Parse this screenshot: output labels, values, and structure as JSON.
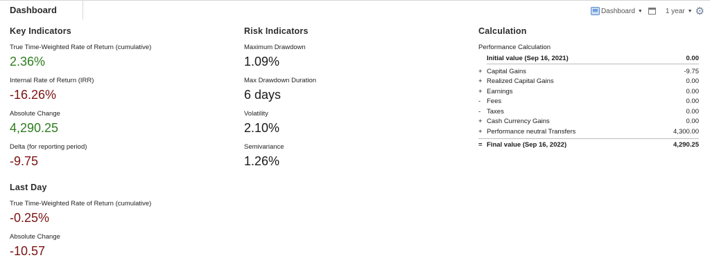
{
  "header": {
    "title": "Dashboard"
  },
  "toolbar": {
    "view_label": "Dashboard",
    "period_label": "1 year"
  },
  "key_indicators": {
    "title": "Key Indicators",
    "items": [
      {
        "label": "True Time-Weighted Rate of Return (cumulative)",
        "value": "2.36%",
        "tone": "pos"
      },
      {
        "label": "Internal Rate of Return (IRR)",
        "value": "-16.26%",
        "tone": "neg"
      },
      {
        "label": "Absolute Change",
        "value": "4,290.25",
        "tone": "pos"
      },
      {
        "label": "Delta (for reporting period)",
        "value": "-9.75",
        "tone": "neg"
      }
    ]
  },
  "risk_indicators": {
    "title": "Risk Indicators",
    "items": [
      {
        "label": "Maximum Drawdown",
        "value": "1.09%"
      },
      {
        "label": "Max Drawdown Duration",
        "value": "6 days"
      },
      {
        "label": "Volatility",
        "value": "2.10%"
      },
      {
        "label": "Semivariance",
        "value": "1.26%"
      }
    ]
  },
  "last_day": {
    "title": "Last Day",
    "items": [
      {
        "label": "True Time-Weighted Rate of Return (cumulative)",
        "value": "-0.25%",
        "tone": "neg"
      },
      {
        "label": "Absolute Change",
        "value": "-10.57",
        "tone": "neg"
      }
    ]
  },
  "calculation": {
    "title": "Calculation",
    "subtitle": "Performance Calculation",
    "initial": {
      "label": "Initial value (Sep 16, 2021)",
      "value": "0.00"
    },
    "rows": [
      {
        "sign": "+",
        "label": "Capital Gains",
        "value": "-9.75"
      },
      {
        "sign": "+",
        "label": "Realized Capital Gains",
        "value": "0.00"
      },
      {
        "sign": "+",
        "label": "Earnings",
        "value": "0.00"
      },
      {
        "sign": "-",
        "label": "Fees",
        "value": "0.00"
      },
      {
        "sign": "-",
        "label": "Taxes",
        "value": "0.00"
      },
      {
        "sign": "+",
        "label": "Cash Currency Gains",
        "value": "0.00"
      },
      {
        "sign": "+",
        "label": "Performance neutral Transfers",
        "value": "4,300.00"
      }
    ],
    "final": {
      "sign": "=",
      "label": "Final value (Sep 16, 2022)",
      "value": "4,290.25"
    }
  },
  "icons": {
    "view": "dashboard-icon",
    "window": "window-icon",
    "settings": "gear-icon"
  }
}
